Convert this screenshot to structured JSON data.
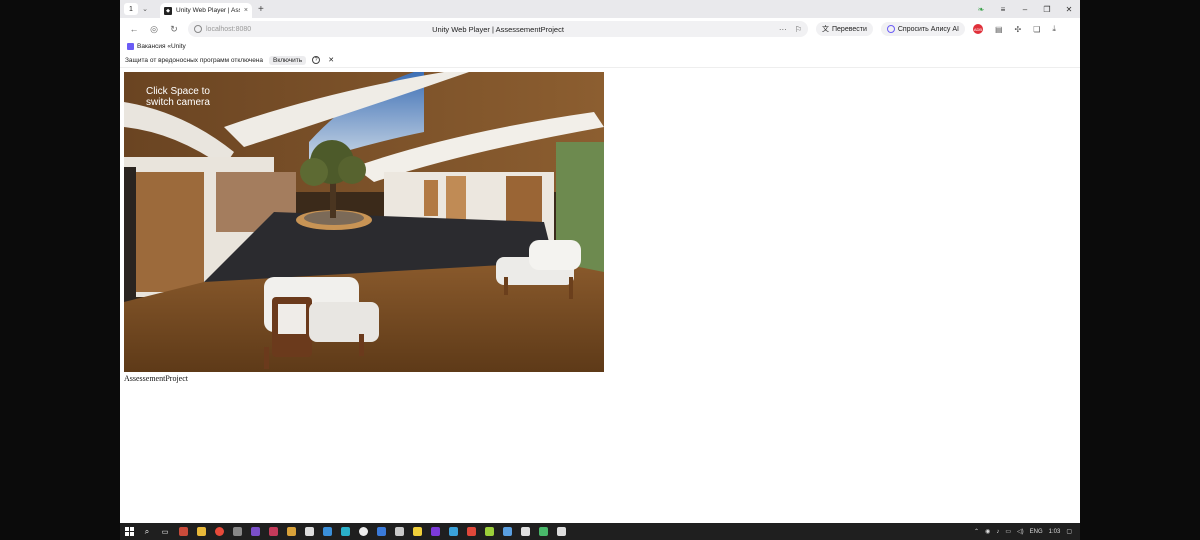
{
  "browser": {
    "tab_count": "1",
    "tab_title": "Unity Web Player | Asse",
    "url": "localhost:8080",
    "page_title": "Unity Web Player | AssessementProject",
    "translate_label": "Перевести",
    "alice_label": "Спросить Алису AI",
    "ext_badge": "ADB"
  },
  "bookmarks": {
    "item_label": "Вакансия «Unity"
  },
  "notice": {
    "text": "Защита от вредоносных программ отключена",
    "enable_label": "Включить"
  },
  "game": {
    "hint": "Click Space to switch camera",
    "project_label": "AssessementProject"
  },
  "taskbar": {
    "lang": "ENG",
    "time": "1:03"
  }
}
